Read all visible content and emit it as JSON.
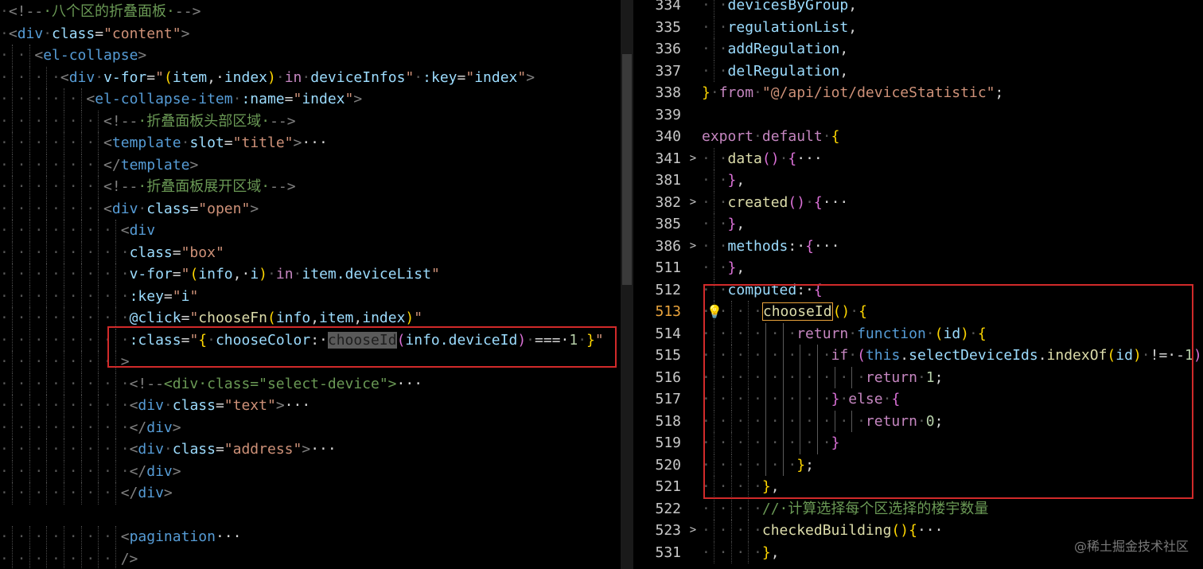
{
  "left_code": [
    {
      "dots": "·",
      "segments": [
        [
          "t",
          "<!--"
        ],
        [
          "cm",
          "·八个区的折叠面板·"
        ],
        [
          "t",
          "-->"
        ]
      ]
    },
    {
      "dots": "·",
      "segments": [
        [
          "t",
          "<"
        ],
        [
          "tg",
          "div"
        ],
        [
          "dot",
          "·"
        ],
        [
          "at",
          "class"
        ],
        [
          "pn",
          "="
        ],
        [
          "st",
          "\"content\""
        ],
        [
          "t",
          ">"
        ]
      ]
    },
    {
      "dots": "·|·|",
      "segments": [
        [
          "t",
          "<"
        ],
        [
          "tg",
          "el-collapse"
        ],
        [
          "t",
          ">"
        ]
      ]
    },
    {
      "dots": "·|·|·|·",
      "segments": [
        [
          "t",
          "<"
        ],
        [
          "tg",
          "div"
        ],
        [
          "dot",
          "·"
        ],
        [
          "at",
          "v-for"
        ],
        [
          "pn",
          "="
        ],
        [
          "st",
          "\""
        ],
        [
          "bk",
          "("
        ],
        [
          "vr",
          "item"
        ],
        [
          "pn",
          ",·"
        ],
        [
          "vr",
          "index"
        ],
        [
          "bk",
          ")"
        ],
        [
          "dot",
          "·"
        ],
        [
          "kw",
          "in"
        ],
        [
          "dot",
          "·"
        ],
        [
          "vr",
          "deviceInfos"
        ],
        [
          "st",
          "\""
        ],
        [
          "dot",
          "·"
        ],
        [
          "at",
          ":key"
        ],
        [
          "pn",
          "="
        ],
        [
          "st",
          "\""
        ],
        [
          "vr",
          "index"
        ],
        [
          "st",
          "\""
        ],
        [
          "t",
          ">"
        ]
      ]
    },
    {
      "dots": "·|·|·|·|·|",
      "segments": [
        [
          "t",
          "<"
        ],
        [
          "tg",
          "el-collapse-item"
        ],
        [
          "dot",
          "·"
        ],
        [
          "at",
          ":name"
        ],
        [
          "pn",
          "="
        ],
        [
          "st",
          "\""
        ],
        [
          "vr",
          "index"
        ],
        [
          "st",
          "\""
        ],
        [
          "t",
          ">"
        ]
      ]
    },
    {
      "dots": "·|·|·|·|·|·|",
      "segments": [
        [
          "t",
          "<!--"
        ],
        [
          "cm",
          "·折叠面板头部区域·"
        ],
        [
          "t",
          "-->"
        ]
      ]
    },
    {
      "dots": "·|·|·|·|·|·|",
      "segments": [
        [
          "t",
          "<"
        ],
        [
          "tg",
          "template"
        ],
        [
          "dot",
          "·"
        ],
        [
          "at",
          "slot"
        ],
        [
          "pn",
          "="
        ],
        [
          "st",
          "\"title\""
        ],
        [
          "t",
          ">"
        ],
        [
          "pn",
          "···"
        ]
      ]
    },
    {
      "dots": "·|·|·|·|·|·|",
      "segments": [
        [
          "t",
          "</"
        ],
        [
          "tg",
          "template"
        ],
        [
          "t",
          ">"
        ]
      ]
    },
    {
      "dots": "·|·|·|·|·|·|",
      "segments": [
        [
          "t",
          "<!--"
        ],
        [
          "cm",
          "·折叠面板展开区域·"
        ],
        [
          "t",
          "-->"
        ]
      ]
    },
    {
      "dots": "·|·|·|·|·|·|",
      "segments": [
        [
          "t",
          "<"
        ],
        [
          "tg",
          "div"
        ],
        [
          "dot",
          "·"
        ],
        [
          "at",
          "class"
        ],
        [
          "pn",
          "="
        ],
        [
          "st",
          "\"open\""
        ],
        [
          "t",
          ">"
        ]
      ]
    },
    {
      "dots": "·|·|·|·|·|·|·|",
      "segments": [
        [
          "t",
          "<"
        ],
        [
          "tg",
          "div"
        ]
      ]
    },
    {
      "dots": "·|·|·|·|·|·|·|·",
      "segments": [
        [
          "at",
          "class"
        ],
        [
          "pn",
          "="
        ],
        [
          "st",
          "\"box\""
        ]
      ]
    },
    {
      "dots": "·|·|·|·|·|·|·|·",
      "segments": [
        [
          "at",
          "v-for"
        ],
        [
          "pn",
          "="
        ],
        [
          "st",
          "\""
        ],
        [
          "bk",
          "("
        ],
        [
          "vr",
          "info"
        ],
        [
          "pn",
          ",·"
        ],
        [
          "vr",
          "i"
        ],
        [
          "bk",
          ")"
        ],
        [
          "dot",
          "·"
        ],
        [
          "kw",
          "in"
        ],
        [
          "dot",
          "·"
        ],
        [
          "vr",
          "item.deviceList"
        ],
        [
          "st",
          "\""
        ]
      ]
    },
    {
      "dots": "·|·|·|·|·|·|·|·",
      "segments": [
        [
          "at",
          ":key"
        ],
        [
          "pn",
          "="
        ],
        [
          "st",
          "\""
        ],
        [
          "vr",
          "i"
        ],
        [
          "st",
          "\""
        ]
      ]
    },
    {
      "dots": "·|·|·|·|·|·|·|·",
      "segments": [
        [
          "at",
          "@click"
        ],
        [
          "pn",
          "="
        ],
        [
          "st",
          "\""
        ],
        [
          "fn",
          "chooseFn"
        ],
        [
          "bk",
          "("
        ],
        [
          "vr",
          "info"
        ],
        [
          "pn",
          ","
        ],
        [
          "vr",
          "item"
        ],
        [
          "pn",
          ","
        ],
        [
          "vr",
          "index"
        ],
        [
          "bk",
          ")"
        ],
        [
          "st",
          "\""
        ]
      ]
    },
    {
      "dots": "·|·|·|·|·|·|·|·",
      "segments": [
        [
          "at",
          ":class"
        ],
        [
          "pn",
          "="
        ],
        [
          "st",
          "\""
        ],
        [
          "bk",
          "{"
        ],
        [
          "dot",
          "·"
        ],
        [
          "vr",
          "chooseColor"
        ],
        [
          "pn",
          ":·"
        ],
        [
          "hl",
          "chooseId"
        ],
        [
          "bk2",
          "("
        ],
        [
          "vr",
          "info.deviceId"
        ],
        [
          "bk2",
          ")"
        ],
        [
          "dot",
          "·"
        ],
        [
          "pn",
          "===·"
        ],
        [
          "nm",
          "1"
        ],
        [
          "dot",
          "·"
        ],
        [
          "bk",
          "}"
        ],
        [
          "st",
          "\""
        ]
      ]
    },
    {
      "dots": "·|·|·|·|·|·|·|",
      "segments": [
        [
          "t",
          ">"
        ]
      ]
    },
    {
      "dots": "·|·|·|·|·|·|·|·",
      "segments": [
        [
          "t",
          "<!--"
        ],
        [
          "cm",
          "<div·class=\"select-device\">"
        ],
        [
          "pn",
          "···"
        ]
      ]
    },
    {
      "dots": "·|·|·|·|·|·|·|·",
      "segments": [
        [
          "t",
          "<"
        ],
        [
          "tg",
          "div"
        ],
        [
          "dot",
          "·"
        ],
        [
          "at",
          "class"
        ],
        [
          "pn",
          "="
        ],
        [
          "st",
          "\"text\""
        ],
        [
          "t",
          ">"
        ],
        [
          "pn",
          "···"
        ]
      ]
    },
    {
      "dots": "·|·|·|·|·|·|·|·",
      "segments": [
        [
          "t",
          "</"
        ],
        [
          "tg",
          "div"
        ],
        [
          "t",
          ">"
        ]
      ]
    },
    {
      "dots": "·|·|·|·|·|·|·|·",
      "segments": [
        [
          "t",
          "<"
        ],
        [
          "tg",
          "div"
        ],
        [
          "dot",
          "·"
        ],
        [
          "at",
          "class"
        ],
        [
          "pn",
          "="
        ],
        [
          "st",
          "\"address\""
        ],
        [
          "t",
          ">"
        ],
        [
          "pn",
          "···"
        ]
      ]
    },
    {
      "dots": "·|·|·|·|·|·|·|·",
      "segments": [
        [
          "t",
          "</"
        ],
        [
          "tg",
          "div"
        ],
        [
          "t",
          ">"
        ]
      ]
    },
    {
      "dots": "·|·|·|·|·|·|·|",
      "segments": [
        [
          "t",
          "</"
        ],
        [
          "tg",
          "div"
        ],
        [
          "t",
          ">"
        ]
      ]
    },
    {
      "dots": "",
      "segments": []
    },
    {
      "dots": "·|·|·|·|·|·|·|",
      "segments": [
        [
          "t",
          "<"
        ],
        [
          "tg",
          "pagination"
        ],
        [
          "pn",
          "···"
        ]
      ]
    },
    {
      "dots": "·|·|·|·|·|·|·|",
      "segments": [
        [
          "t",
          "/>"
        ]
      ]
    }
  ],
  "right_code": [
    {
      "num": "334",
      "fold": "",
      "dots": "·|·",
      "segments": [
        [
          "vr",
          "devicesByGroup"
        ],
        [
          "pn",
          ","
        ]
      ]
    },
    {
      "num": "335",
      "fold": "",
      "dots": "·|·",
      "segments": [
        [
          "vr",
          "regulationList"
        ],
        [
          "pn",
          ","
        ]
      ]
    },
    {
      "num": "336",
      "fold": "",
      "dots": "·|·",
      "segments": [
        [
          "vr",
          "addRegulation"
        ],
        [
          "pn",
          ","
        ]
      ]
    },
    {
      "num": "337",
      "fold": "",
      "dots": "·|·",
      "segments": [
        [
          "vr",
          "delRegulation"
        ],
        [
          "pn",
          ","
        ]
      ]
    },
    {
      "num": "338",
      "fold": "",
      "dots": "",
      "segments": [
        [
          "bk",
          "}"
        ],
        [
          "dot",
          "·"
        ],
        [
          "kw",
          "from"
        ],
        [
          "dot",
          "·"
        ],
        [
          "st",
          "\"@/api/iot/deviceStatistic\""
        ],
        [
          "pn",
          ";"
        ]
      ]
    },
    {
      "num": "339",
      "fold": "",
      "dots": "",
      "segments": []
    },
    {
      "num": "340",
      "fold": "",
      "dots": "",
      "segments": [
        [
          "kw",
          "export"
        ],
        [
          "dot",
          "·"
        ],
        [
          "kw",
          "default"
        ],
        [
          "dot",
          "·"
        ],
        [
          "bk",
          "{"
        ]
      ]
    },
    {
      "num": "341",
      "fold": ">",
      "dots": "·|·",
      "segments": [
        [
          "fn",
          "data"
        ],
        [
          "bk2",
          "()"
        ],
        [
          "dot",
          "·"
        ],
        [
          "bk2",
          "{"
        ],
        [
          "pn",
          "···"
        ]
      ]
    },
    {
      "num": "381",
      "fold": "",
      "dots": "·|·",
      "segments": [
        [
          "bk2",
          "}"
        ],
        [
          "pn",
          ","
        ]
      ]
    },
    {
      "num": "382",
      "fold": ">",
      "dots": "·|·",
      "segments": [
        [
          "fn",
          "created"
        ],
        [
          "bk2",
          "()"
        ],
        [
          "dot",
          "·"
        ],
        [
          "bk2",
          "{"
        ],
        [
          "pn",
          "···"
        ]
      ]
    },
    {
      "num": "385",
      "fold": "",
      "dots": "·|·",
      "segments": [
        [
          "bk2",
          "}"
        ],
        [
          "pn",
          ","
        ]
      ]
    },
    {
      "num": "386",
      "fold": ">",
      "dots": "·|·",
      "segments": [
        [
          "vr",
          "methods"
        ],
        [
          "pn",
          ":·"
        ],
        [
          "bk2",
          "{"
        ],
        [
          "pn",
          "···"
        ]
      ]
    },
    {
      "num": "511",
      "fold": "",
      "dots": "·|·",
      "segments": [
        [
          "bk2",
          "}"
        ],
        [
          "pn",
          ","
        ]
      ]
    },
    {
      "num": "512",
      "fold": "",
      "dots": "·|·",
      "segments": [
        [
          "vr",
          "computed"
        ],
        [
          "pn",
          ":·"
        ],
        [
          "bk2",
          "{"
        ]
      ]
    },
    {
      "num": "513",
      "fold": "",
      "dots": "·|·|·|·",
      "active": true,
      "segments": [
        [
          "hlbox",
          "chooseId"
        ],
        [
          "bk",
          "()"
        ],
        [
          "dot",
          "·"
        ],
        [
          "bk",
          "{"
        ]
      ]
    },
    {
      "num": "514",
      "fold": "",
      "dots": "·|·|·|·|·|·",
      "segments": [
        [
          "kw",
          "return"
        ],
        [
          "dot",
          "·"
        ],
        [
          "tg",
          "function"
        ],
        [
          "dot",
          "·"
        ],
        [
          "bk",
          "("
        ],
        [
          "vr",
          "id"
        ],
        [
          "bk",
          ")"
        ],
        [
          "dot",
          "·"
        ],
        [
          "bk",
          "{"
        ]
      ]
    },
    {
      "num": "515",
      "fold": "",
      "dots": "·|·|·|·|·|·|·|·",
      "segments": [
        [
          "kw",
          "if"
        ],
        [
          "dot",
          "·"
        ],
        [
          "bk2",
          "("
        ],
        [
          "tg",
          "this"
        ],
        [
          "pn",
          "."
        ],
        [
          "vr",
          "selectDeviceIds"
        ],
        [
          "pn",
          "."
        ],
        [
          "fn",
          "indexOf"
        ],
        [
          "bk",
          "("
        ],
        [
          "vr",
          "id"
        ],
        [
          "bk",
          ")"
        ],
        [
          "dot",
          "·"
        ],
        [
          "pn",
          "!=·-"
        ],
        [
          "nm",
          "1"
        ],
        [
          "bk2",
          ")"
        ],
        [
          "dot",
          "·"
        ],
        [
          "bk2",
          "{"
        ]
      ]
    },
    {
      "num": "516",
      "fold": "",
      "dots": "·|·|·|·|·|·|·|·|·|·",
      "segments": [
        [
          "kw",
          "return"
        ],
        [
          "dot",
          "·"
        ],
        [
          "nm",
          "1"
        ],
        [
          "pn",
          ";"
        ]
      ]
    },
    {
      "num": "517",
      "fold": "",
      "dots": "·|·|·|·|·|·|·|·",
      "segments": [
        [
          "bk2",
          "}"
        ],
        [
          "dot",
          "·"
        ],
        [
          "kw",
          "else"
        ],
        [
          "dot",
          "·"
        ],
        [
          "bk2",
          "{"
        ]
      ]
    },
    {
      "num": "518",
      "fold": "",
      "dots": "·|·|·|·|·|·|·|·|·|·",
      "segments": [
        [
          "kw",
          "return"
        ],
        [
          "dot",
          "·"
        ],
        [
          "nm",
          "0"
        ],
        [
          "pn",
          ";"
        ]
      ]
    },
    {
      "num": "519",
      "fold": "",
      "dots": "·|·|·|·|·|·|·|·",
      "segments": [
        [
          "bk2",
          "}"
        ]
      ]
    },
    {
      "num": "520",
      "fold": "",
      "dots": "·|·|·|·|·|·",
      "segments": [
        [
          "bk",
          "}"
        ],
        [
          "pn",
          ";"
        ]
      ]
    },
    {
      "num": "521",
      "fold": "",
      "dots": "·|·|·|·",
      "segments": [
        [
          "bk",
          "}"
        ],
        [
          "pn",
          ","
        ]
      ]
    },
    {
      "num": "522",
      "fold": "",
      "dots": "·|·|·|·",
      "segments": [
        [
          "cm",
          "//·计算选择每个区选择的楼宇数量"
        ]
      ]
    },
    {
      "num": "523",
      "fold": ">",
      "dots": "·|·|·|·",
      "segments": [
        [
          "fn",
          "checkedBuilding"
        ],
        [
          "bk",
          "(){"
        ],
        [
          "pn",
          "···"
        ]
      ]
    },
    {
      "num": "531",
      "fold": "",
      "dots": "·|·|·|·",
      "segments": [
        [
          "bk",
          "}"
        ],
        [
          "pn",
          ","
        ]
      ]
    }
  ],
  "watermark": "@稀土掘金技术社区"
}
